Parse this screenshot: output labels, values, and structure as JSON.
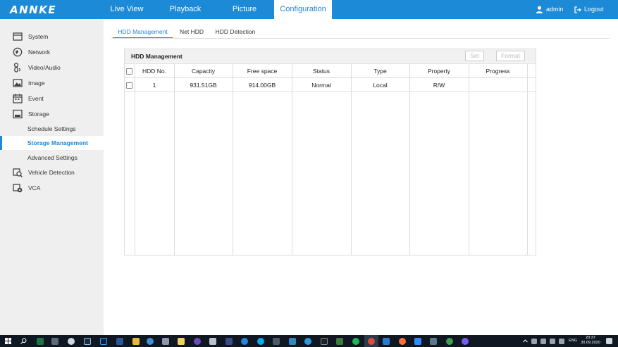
{
  "brand": {
    "logo": "ANNKE"
  },
  "topnav": {
    "tabs": [
      {
        "label": "Live View"
      },
      {
        "label": "Playback"
      },
      {
        "label": "Picture"
      },
      {
        "label": "Configuration",
        "active": true
      }
    ],
    "user": "admin",
    "logout": "Logout"
  },
  "sidebar": {
    "items": [
      {
        "label": "System",
        "icon": "system-icon"
      },
      {
        "label": "Network",
        "icon": "network-icon"
      },
      {
        "label": "Video/Audio",
        "icon": "video-audio-icon"
      },
      {
        "label": "Image",
        "icon": "image-icon"
      },
      {
        "label": "Event",
        "icon": "event-icon"
      },
      {
        "label": "Storage",
        "icon": "storage-icon"
      },
      {
        "label": "Vehicle Detection",
        "icon": "vehicle-detection-icon"
      },
      {
        "label": "VCA",
        "icon": "vca-icon"
      }
    ],
    "storage_sub": [
      {
        "label": "Schedule Settings"
      },
      {
        "label": "Storage Management",
        "active": true
      },
      {
        "label": "Advanced Settings"
      }
    ]
  },
  "subtabs": [
    {
      "label": "HDD Management",
      "active": true
    },
    {
      "label": "Net HDD"
    },
    {
      "label": "HDD Detection"
    }
  ],
  "panel": {
    "title": "HDD Management",
    "set_label": "Set",
    "format_label": "Format",
    "columns": [
      "HDD No.",
      "Capacity",
      "Free space",
      "Status",
      "Type",
      "Property",
      "Progress"
    ],
    "rows": [
      {
        "no": "1",
        "capacity": "931.51GB",
        "free": "914.00GB",
        "status": "Normal",
        "type": "Local",
        "property": "R/W",
        "progress": ""
      }
    ]
  },
  "taskbar": {
    "lang": "ENG",
    "time": "20:37",
    "date": "30.09.2020"
  },
  "colors": {
    "accent": "#1c8ad6",
    "sidebar_bg": "#efefef",
    "taskbar_bg": "#0f1722"
  }
}
